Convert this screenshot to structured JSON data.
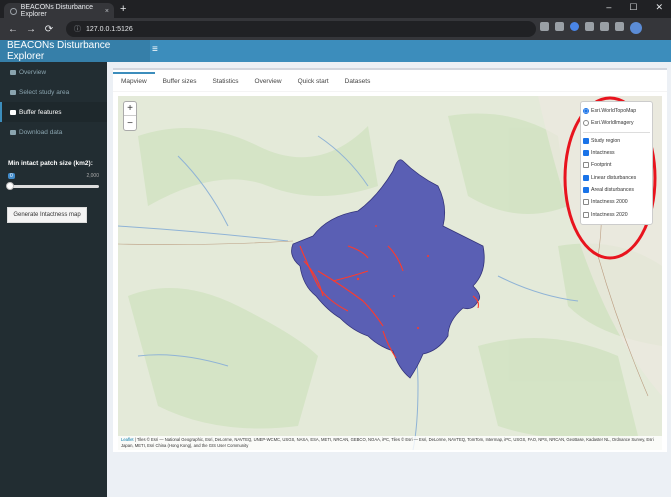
{
  "browser": {
    "tab_title": "BEACONs Disturbance Explorer",
    "tab_close": "×",
    "new_tab": "+",
    "url": "127.0.0.1:5126",
    "nav_icons": [
      "back-arrow-icon",
      "forward-arrow-icon",
      "reload-icon"
    ]
  },
  "app": {
    "title": "BEACONs Disturbance Explorer",
    "header_color": "#3c8dbc"
  },
  "sidebar": {
    "items": [
      {
        "label": "Overview"
      },
      {
        "label": "Select study area"
      },
      {
        "label": "Buffer features"
      },
      {
        "label": "Download data"
      }
    ],
    "active_index": 2,
    "slider_label": "Min intact patch size (km2):",
    "slider_min": "0",
    "slider_max": "2,000",
    "slider_value_fraction": 0,
    "button_label": "Generate Intactness map"
  },
  "main": {
    "tabs": [
      {
        "label": "Mapview"
      },
      {
        "label": "Buffer sizes"
      },
      {
        "label": "Statistics"
      },
      {
        "label": "Overview"
      },
      {
        "label": "Quick start"
      },
      {
        "label": "Datasets"
      }
    ],
    "active_tab": 0
  },
  "map": {
    "zoom_in": "+",
    "zoom_out": "−",
    "basemaps": [
      {
        "label": "Esri.WorldTopoMap",
        "checked": true
      },
      {
        "label": "Esri.WorldImagery",
        "checked": false
      }
    ],
    "overlays": [
      {
        "label": "Study region",
        "checked": true
      },
      {
        "label": "Intactness",
        "checked": true
      },
      {
        "label": "Footprint",
        "checked": false
      },
      {
        "label": "Linear disturbances",
        "checked": true
      },
      {
        "label": "Areal disturbances",
        "checked": true
      },
      {
        "label": "Intactness 2000",
        "checked": false
      },
      {
        "label": "Intactness 2020",
        "checked": false
      }
    ],
    "attribution_link": "Leaflet",
    "attribution": " | Tiles © Esri — National Geographic, Esri, DeLorme, NAVTEQ, UNEP-WCMC, USGS, NASA, ESA, METI, NRCAN, GEBCO, NOAA, iPC, Tiles © Esri — Esri, DeLorme, NAVTEQ, TomTom, Intermap, iPC, USGS, FAO, NPS, NRCAN, GeoBase, Kadaster NL, Ordnance Survey, Esri Japan, METI, Esri China (Hong Kong), and the GIS User Community",
    "colors": {
      "study_region": "#5a5fb4",
      "disturbance": "#ff3a2a",
      "highlight_circle": "#e8141e"
    }
  }
}
